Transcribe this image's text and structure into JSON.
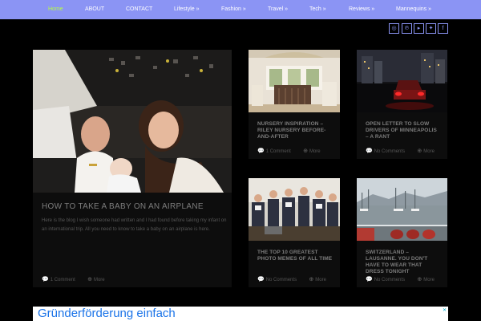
{
  "nav": {
    "items": [
      {
        "label": "Home",
        "active": true
      },
      {
        "label": "ABOUT"
      },
      {
        "label": "CONTACT"
      },
      {
        "label": "Lifestyle »"
      },
      {
        "label": "Fashion »"
      },
      {
        "label": "Travel »"
      },
      {
        "label": "Tech »"
      },
      {
        "label": "Reviews »"
      },
      {
        "label": "Mannequins »"
      }
    ]
  },
  "social": [
    "instagram-icon",
    "pinterest-icon",
    "youtube-icon",
    "twitter-icon",
    "facebook-icon"
  ],
  "featured": {
    "title": "HOW TO TAKE A BABY ON AN AIRPLANE",
    "excerpt": "Here is the blog I wish someone had written and I had found before taking my infant on an international trip. All you need to know to take a baby on an airplane is here.",
    "comments": "1 Comment",
    "more": "More"
  },
  "posts": [
    {
      "title": "NURSERY INSPIRATION – RILEY NURSERY BEFORE-AND-AFTER",
      "comments": "1 Comment",
      "more": "More"
    },
    {
      "title": "OPEN LETTER TO SLOW DRIVERS OF MINNEAPOLIS – A RANT",
      "comments": "No Comments",
      "more": "More"
    },
    {
      "title": "THE TOP 10 GREATEST PHOTO MEMES OF ALL TIME",
      "comments": "No Comments",
      "more": "More"
    },
    {
      "title": "SWITZERLAND – LAUSANNE. YOU DON'T HAVE TO WEAR THAT DRESS TONIGHT",
      "comments": "No Comments",
      "more": "More"
    }
  ],
  "ad": {
    "text": "Gründerförderung einfach",
    "close": "✕"
  },
  "colors": {
    "nav": "#8b94f4",
    "active": "#b7ff3f",
    "background": "#000000"
  }
}
